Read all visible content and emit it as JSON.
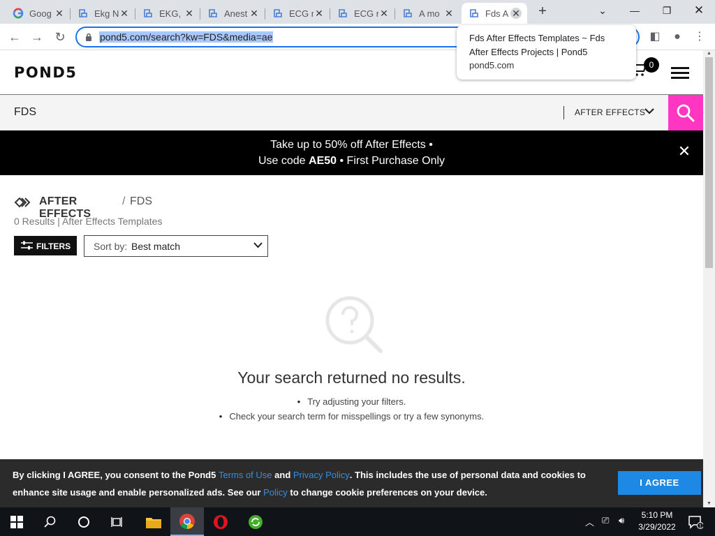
{
  "browser": {
    "tabs": [
      {
        "title": "Goog",
        "favicon": "google-icon"
      },
      {
        "title": "Ekg N",
        "favicon": "pond5-icon"
      },
      {
        "title": "EKG, l",
        "favicon": "pond5-icon"
      },
      {
        "title": "Anest",
        "favicon": "pond5-icon"
      },
      {
        "title": "ECG r",
        "favicon": "pond5-icon"
      },
      {
        "title": "ECG r",
        "favicon": "pond5-icon"
      },
      {
        "title": "A mo",
        "favicon": "pond5-icon"
      },
      {
        "title": "Fds A",
        "favicon": "pond5-icon",
        "active": true
      }
    ],
    "new_tab": "+",
    "url": "pond5.com/search?kw=FDS&media=ae",
    "tooltip": {
      "title": "Fds After Effects Templates ~ Fds After Effects Projects | Pond5",
      "domain": "pond5.com"
    }
  },
  "site": {
    "logo": "POND5",
    "cart_count": "0",
    "search": {
      "query": "FDS",
      "media_type": "AFTER EFFECTS"
    },
    "promo": {
      "line1": "Take up to 50% off After Effects •",
      "line2_pre": "Use code ",
      "line2_code": "AE50",
      "line2_post": " • First Purchase Only"
    },
    "breadcrumb": {
      "category": "AFTER EFFECTS",
      "separator": "/",
      "term": "FDS"
    },
    "results_summary": "0 Results | After Effects Templates",
    "filters_label": "FILTERS",
    "sort": {
      "prefix": "Sort by:",
      "value": "Best match"
    },
    "empty_state": {
      "title": "Your search returned no results.",
      "tips": [
        "Try adjusting your filters.",
        "Check your search term for misspellings or try a few synonyms."
      ]
    },
    "cookie": {
      "t1": "By clicking I AGREE, you consent to the Pond5 ",
      "link1": "Terms of Use",
      "t2": " and ",
      "link2": "Privacy Policy",
      "t3": ". This includes the use of personal data and cookies to enhance site usage and enable personalized ads. See our ",
      "link3": "Policy",
      "t4": " to change cookie preferences on your device.",
      "button": "I AGREE"
    },
    "colors": {
      "search_button": "#ff36c2",
      "promo_bg": "#000000",
      "cookie_button": "#1e88e5",
      "link": "#3a8dde"
    }
  },
  "taskbar": {
    "time": "5:10 PM",
    "date": "3/29/2022",
    "notifications": "1"
  }
}
